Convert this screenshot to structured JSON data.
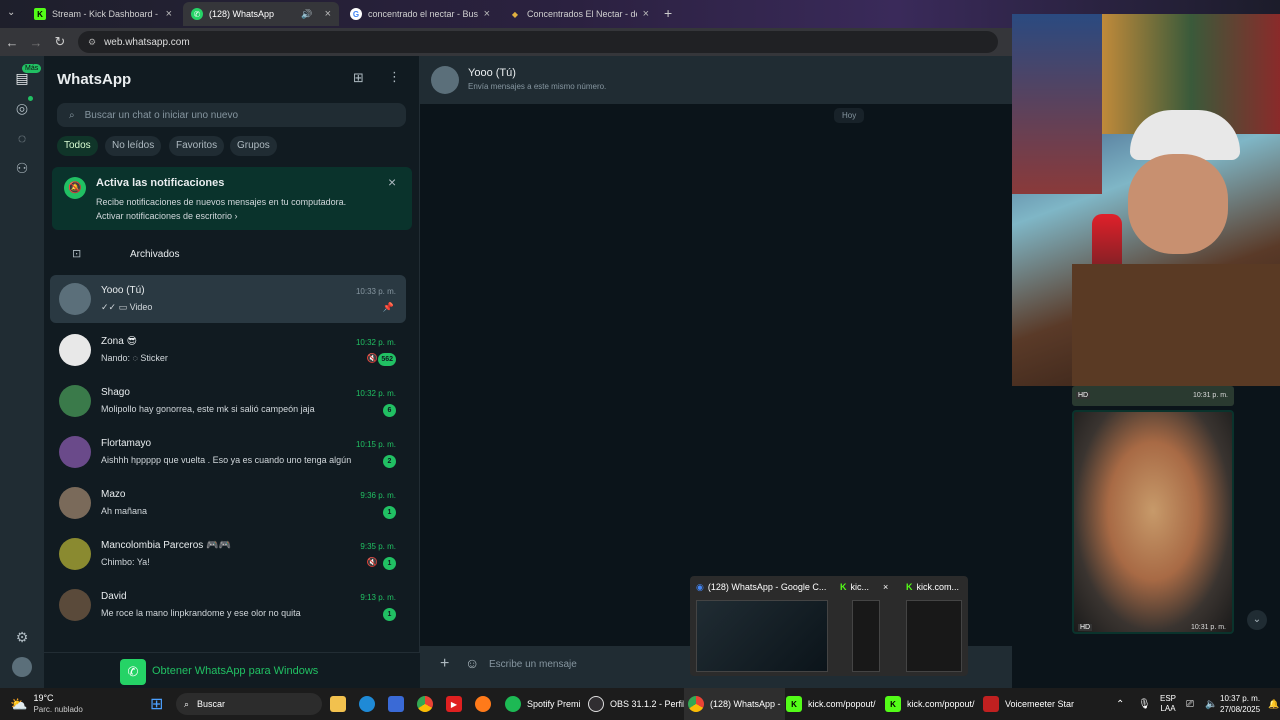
{
  "browser": {
    "tabs": [
      {
        "title": "Stream - Kick Dashboard -",
        "fav": "K",
        "color": "#53fc18"
      },
      {
        "title": "(128) WhatsApp",
        "fav": "✆",
        "color": "#25d366"
      },
      {
        "title": "concentrado el nectar - Buscar",
        "fav": "G",
        "color": "#4285f4"
      },
      {
        "title": "Concentrados El Nectar - depo",
        "fav": "◆",
        "color": "#e0b040"
      }
    ],
    "url": "web.whatsapp.com"
  },
  "rail": {
    "badge": "Más"
  },
  "sidebar": {
    "title": "WhatsApp",
    "search_placeholder": "Buscar un chat o iniciar uno nuevo",
    "filters": [
      "Todos",
      "No leídos",
      "Favoritos",
      "Grupos"
    ],
    "notif": {
      "title": "Activa las notificaciones",
      "body": "Recibe notificaciones de nuevos mensajes en tu computadora.",
      "link": "Activar notificaciones de escritorio ›"
    },
    "archived": "Archivados",
    "chats": [
      {
        "name": "Yooo (Tú)",
        "msg": "✓✓ ▭ Video",
        "time": "10:33 p. m.",
        "badge": "",
        "muted": false,
        "pinned": true,
        "color": "#5b6f7a"
      },
      {
        "name": "Zona 😎",
        "msg": "Nando: ◌ Sticker",
        "time": "10:32 p. m.",
        "badge": "562",
        "muted": true,
        "pinned": false,
        "color": "#e8e8e8"
      },
      {
        "name": "Shago",
        "msg": "Molipollo hay gonorrea, este mk si salió campeón jaja",
        "time": "10:32 p. m.",
        "badge": "6",
        "muted": false,
        "pinned": false,
        "color": "#3a7a4a"
      },
      {
        "name": "Flortamayo",
        "msg": "Aishhh hppppp que vuelta . Eso ya es cuando uno tenga algún co...",
        "time": "10:15 p. m.",
        "badge": "2",
        "muted": false,
        "pinned": false,
        "color": "#6a4a8a"
      },
      {
        "name": "Mazo",
        "msg": "Ah mañana",
        "time": "9:36 p. m.",
        "badge": "1",
        "muted": false,
        "pinned": false,
        "color": "#7a6a5a"
      },
      {
        "name": "Mancolombia Parceros 🎮🎮",
        "msg": "Chimbo: Ya!",
        "time": "9:35 p. m.",
        "badge": "1",
        "muted": true,
        "pinned": false,
        "color": "#8a8a30"
      },
      {
        "name": "David",
        "msg": "Me roce la mano linpkrandome y ese olor no quita",
        "time": "9:13 p. m.",
        "badge": "1",
        "muted": false,
        "pinned": false,
        "color": "#5a4a3a"
      }
    ],
    "get_windows": "Obtener WhatsApp para Windows"
  },
  "chat": {
    "name": "Yooo (Tú)",
    "subtitle": "Envía mensajes a este mismo número.",
    "day": "Hoy",
    "composer_placeholder": "Escribe un mensaje",
    "media_time_1": "10:31 p. m.",
    "media_time_2": "10:31 p. m.",
    "hd": "HD"
  },
  "thumbs": [
    {
      "title": "(128) WhatsApp - Google C..."
    },
    {
      "title": "kic..."
    },
    {
      "title": "kick.com..."
    }
  ],
  "taskbar": {
    "weather_temp": "19°C",
    "weather_desc": "Parc. nublado",
    "search": "Buscar",
    "spotify": "Spotify Premi",
    "obs": "OBS 31.1.2 - Perfil:",
    "whatsapp": "(128) WhatsApp -",
    "kick1": "kick.com/popout/",
    "kick2": "kick.com/popout/",
    "voicemeeter": "Voicemeeter Star",
    "lang1": "ESP",
    "lang2": "LAA",
    "time": "10:37 p. m.",
    "date": "27/08/2025"
  }
}
